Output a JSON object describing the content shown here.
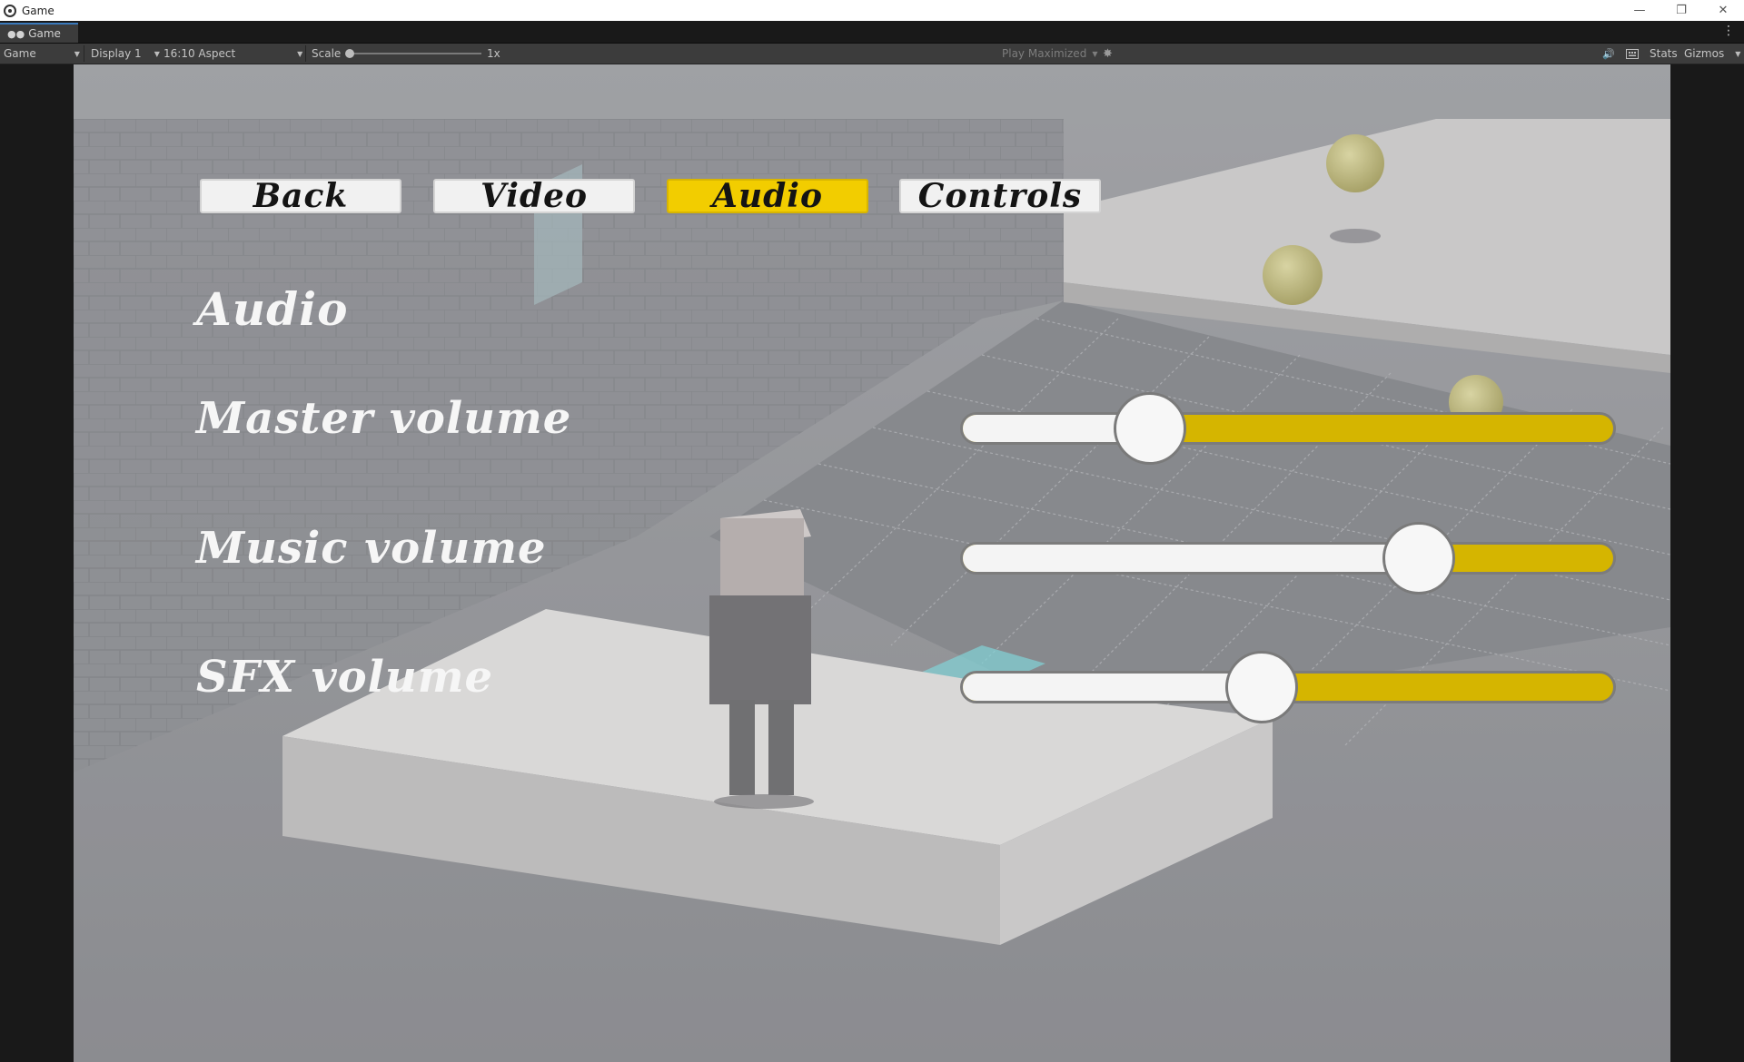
{
  "window": {
    "title": "Game",
    "controls": {
      "minimize": "—",
      "restore": "❐",
      "close": "✕"
    }
  },
  "tabs": [
    {
      "label": "Game",
      "icon": "gamepad-icon"
    }
  ],
  "toolbar": {
    "mode": "Game",
    "display": "Display 1",
    "aspect": "16:10 Aspect",
    "scale_label": "Scale",
    "scale_value": "1x",
    "play_mode": "Play Maximized",
    "stats": "Stats",
    "gizmos": "Gizmos"
  },
  "game_ui": {
    "buttons": [
      {
        "label": "Back",
        "active": false
      },
      {
        "label": "Video",
        "active": false
      },
      {
        "label": "Audio",
        "active": true
      },
      {
        "label": "Controls",
        "active": false
      }
    ],
    "heading": "Audio",
    "sliders": [
      {
        "label": "Master volume",
        "value": 0.29
      },
      {
        "label": "Music volume",
        "value": 0.7
      },
      {
        "label": "SFX volume",
        "value": 0.46
      }
    ]
  },
  "colors": {
    "accent": "#f2cd00",
    "slider_fill": "#d5b500",
    "editor_bg": "#3c3c3c",
    "tab_highlight": "#3a79bb"
  }
}
